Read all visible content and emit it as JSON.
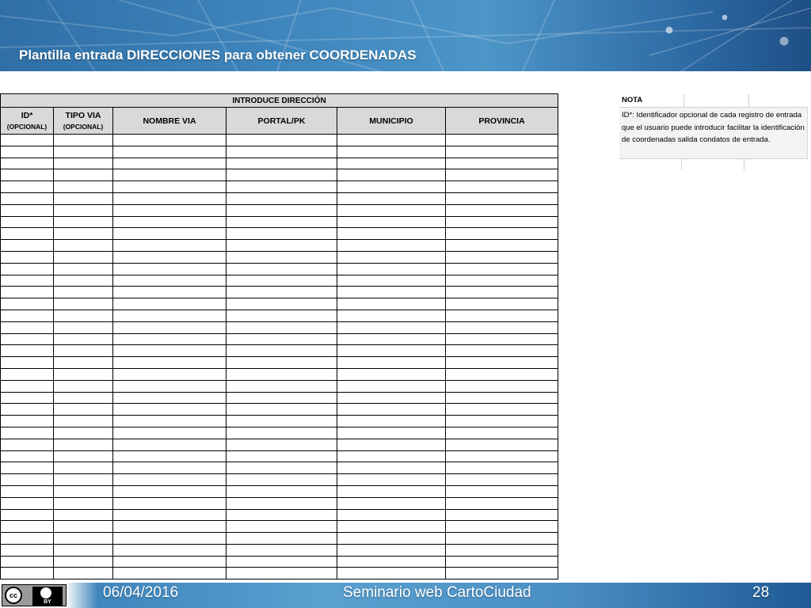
{
  "header": {
    "title": "Plantilla entrada DIRECCIONES para obtener COORDENADAS"
  },
  "spreadsheet": {
    "group_header": "INTRODUCE DIRECCIÓN",
    "columns": [
      {
        "label": "ID*",
        "sub": "(OPCIONAL)"
      },
      {
        "label": "TIPO VIA",
        "sub": "(OPCIONAL)"
      },
      {
        "label": "NOMBRE VIA",
        "sub": ""
      },
      {
        "label": "PORTAL/PK",
        "sub": ""
      },
      {
        "label": "MUNICIPIO",
        "sub": ""
      },
      {
        "label": "PROVINCIA",
        "sub": ""
      }
    ]
  },
  "note": {
    "title": "NOTA",
    "text": "ID*: Identificador opcional de cada registro de entrada que el usuario puede introducir facilitar la identificación de coordenadas salida condatos de entrada."
  },
  "footer": {
    "date": "06/04/2016",
    "title": "Seminario web CartoCiudad",
    "page": "28",
    "license_label": "BY",
    "license_cc": "cc"
  },
  "colors": {
    "header_blue": "#3f86bd",
    "grid_header_gray": "#d9d9d9"
  }
}
